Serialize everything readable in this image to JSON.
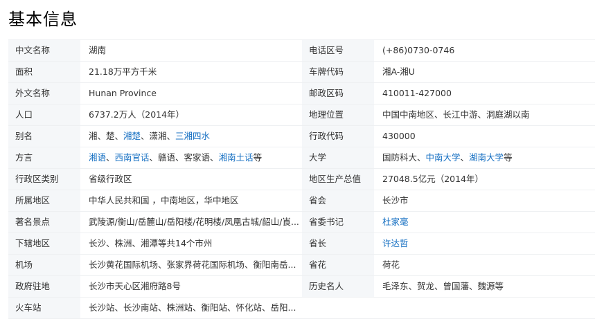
{
  "title": "基本信息",
  "rows": [
    {
      "left": {
        "label": "中文名称",
        "value": [
          {
            "t": "湖南"
          }
        ]
      },
      "right": {
        "label": "电话区号",
        "value": [
          {
            "t": "(+86)0730-0746"
          }
        ]
      }
    },
    {
      "left": {
        "label": "面积",
        "value": [
          {
            "t": "21.18万平方千米"
          }
        ]
      },
      "right": {
        "label": "车牌代码",
        "value": [
          {
            "t": "湘A-湘U"
          }
        ]
      }
    },
    {
      "left": {
        "label": "外文名称",
        "value": [
          {
            "t": "Hunan Province"
          }
        ]
      },
      "right": {
        "label": "邮政区码",
        "value": [
          {
            "t": "410011-427000"
          }
        ]
      }
    },
    {
      "left": {
        "label": "人口",
        "value": [
          {
            "t": "6737.2万人（2014年）"
          }
        ]
      },
      "right": {
        "label": "地理位置",
        "value": [
          {
            "t": "中国中南地区、长江中游、洞庭湖以南"
          }
        ]
      }
    },
    {
      "left": {
        "label": "别名",
        "value": [
          {
            "t": "湘、楚、"
          },
          {
            "t": "湘楚",
            "link": true
          },
          {
            "t": "、潇湘、"
          },
          {
            "t": "三湘四水",
            "link": true
          }
        ]
      },
      "right": {
        "label": "行政代码",
        "value": [
          {
            "t": "430000"
          }
        ]
      }
    },
    {
      "left": {
        "label": "方言",
        "value": [
          {
            "t": "湘语",
            "link": true
          },
          {
            "t": "、"
          },
          {
            "t": "西南官话",
            "link": true
          },
          {
            "t": "、赣语、客家语、"
          },
          {
            "t": "湘南土话",
            "link": true
          },
          {
            "t": "等"
          }
        ]
      },
      "right": {
        "label": "大学",
        "value": [
          {
            "t": "国防科大、"
          },
          {
            "t": "中南大学",
            "link": true
          },
          {
            "t": "、"
          },
          {
            "t": "湖南大学",
            "link": true
          },
          {
            "t": "等"
          }
        ]
      }
    },
    {
      "left": {
        "label": "行政区类别",
        "value": [
          {
            "t": "省级行政区"
          }
        ]
      },
      "right": {
        "label": "地区生产总值",
        "value": [
          {
            "t": "27048.5亿元（2014年）"
          }
        ]
      }
    },
    {
      "left": {
        "label": "所属地区",
        "value": [
          {
            "t": "中华人民共和国 ，中南地区，华中地区"
          }
        ]
      },
      "right": {
        "label": "省会",
        "value": [
          {
            "t": "长沙市"
          }
        ]
      }
    },
    {
      "left": {
        "label": "著名景点",
        "value": [
          {
            "t": "武陵源/衡山/岳麓山/岳阳楼/花明楼/凤凰古城/韶山/崀..."
          }
        ]
      },
      "right": {
        "label": "省委书记",
        "value": [
          {
            "t": "杜家毫",
            "link": true
          }
        ]
      }
    },
    {
      "left": {
        "label": "下辖地区",
        "value": [
          {
            "t": "长沙、株洲、湘潭等共14个市州"
          }
        ]
      },
      "right": {
        "label": "省长",
        "value": [
          {
            "t": "许达哲",
            "link": true
          }
        ]
      }
    },
    {
      "left": {
        "label": "机场",
        "value": [
          {
            "t": "长沙黄花国际机场、张家界荷花国际机场、衡阳南岳..."
          }
        ]
      },
      "right": {
        "label": "省花",
        "value": [
          {
            "t": "荷花"
          }
        ]
      }
    },
    {
      "left": {
        "label": "政府驻地",
        "value": [
          {
            "t": "长沙市天心区湘府路8号"
          }
        ]
      },
      "right": {
        "label": "历史名人",
        "value": [
          {
            "t": "毛泽东、贺龙、曾国藩、魏源等"
          }
        ]
      }
    },
    {
      "left": {
        "label": "火车站",
        "value": [
          {
            "t": "长沙站、长沙南站、株洲站、衡阳站、怀化站、岳阳..."
          }
        ]
      },
      "right": null
    }
  ]
}
